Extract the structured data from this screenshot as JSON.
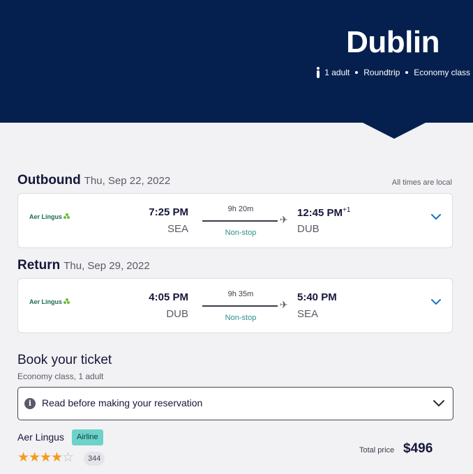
{
  "header": {
    "destination": "Dublin",
    "passengers": "1 adult",
    "trip_type": "Roundtrip",
    "cabin": "Economy class",
    "bg_color": "#05204f"
  },
  "outbound": {
    "label": "Outbound",
    "date": "Thu, Sep 22, 2022",
    "times_note": "All times are local",
    "airline_logo_text": "Aer Lingus",
    "depart_time": "7:25 PM",
    "depart_airport": "SEA",
    "duration": "9h 20m",
    "stops": "Non-stop",
    "arrive_time": "12:45 PM",
    "arrive_day_offset": "+1",
    "arrive_airport": "DUB"
  },
  "return": {
    "label": "Return",
    "date": "Thu, Sep 29, 2022",
    "airline_logo_text": "Aer Lingus",
    "depart_time": "4:05 PM",
    "depart_airport": "DUB",
    "duration": "9h 35m",
    "stops": "Non-stop",
    "arrive_time": "5:40 PM",
    "arrive_airport": "SEA"
  },
  "booking": {
    "title": "Book your ticket",
    "subtitle": "Economy class, 1 adult",
    "notice": "Read before making your reservation",
    "airline_name": "Aer Lingus",
    "airline_badge": "Airline",
    "rating": 4,
    "rating_max": 5,
    "review_count": "344",
    "total_label": "Total price",
    "total_price": "$496",
    "star_color": "#f39b1f",
    "accent_color": "#1a73c7"
  }
}
